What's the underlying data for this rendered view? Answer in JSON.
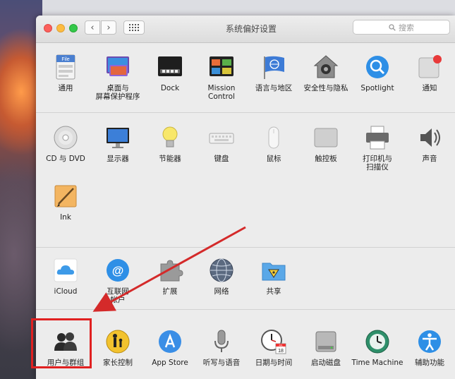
{
  "window": {
    "title": "系统偏好设置",
    "search_placeholder": "搜索"
  },
  "sections": [
    {
      "name": "personal",
      "panes": [
        {
          "id": "general",
          "label": "通用",
          "icon": "general-icon"
        },
        {
          "id": "desktop",
          "label": "桌面与\n屏幕保护程序",
          "icon": "desktop-icon"
        },
        {
          "id": "dock",
          "label": "Dock",
          "icon": "dock-icon"
        },
        {
          "id": "mission-control",
          "label": "Mission\nControl",
          "icon": "mission-control-icon"
        },
        {
          "id": "language",
          "label": "语言与地区",
          "icon": "language-flag-icon"
        },
        {
          "id": "security",
          "label": "安全性与隐私",
          "icon": "security-house-icon"
        },
        {
          "id": "spotlight",
          "label": "Spotlight",
          "icon": "spotlight-icon"
        },
        {
          "id": "notifications",
          "label": "通知",
          "icon": "notifications-icon"
        }
      ]
    },
    {
      "name": "hardware",
      "panes": [
        {
          "id": "cd-dvd",
          "label": "CD 与 DVD",
          "icon": "cd-icon"
        },
        {
          "id": "displays",
          "label": "显示器",
          "icon": "display-icon"
        },
        {
          "id": "energy",
          "label": "节能器",
          "icon": "lightbulb-icon"
        },
        {
          "id": "keyboard",
          "label": "键盘",
          "icon": "keyboard-icon"
        },
        {
          "id": "mouse",
          "label": "鼠标",
          "icon": "mouse-icon"
        },
        {
          "id": "trackpad",
          "label": "触控板",
          "icon": "trackpad-icon"
        },
        {
          "id": "printers",
          "label": "打印机与\n扫描仪",
          "icon": "printer-icon"
        },
        {
          "id": "sound",
          "label": "声音",
          "icon": "speaker-icon"
        },
        {
          "id": "ink",
          "label": "Ink",
          "icon": "ink-icon"
        }
      ]
    },
    {
      "name": "internet",
      "panes": [
        {
          "id": "icloud",
          "label": "iCloud",
          "icon": "icloud-icon"
        },
        {
          "id": "internet-accounts",
          "label": "互联网\n帐户",
          "icon": "at-sign-icon"
        },
        {
          "id": "extensions",
          "label": "扩展",
          "icon": "puzzle-icon"
        },
        {
          "id": "network",
          "label": "网络",
          "icon": "globe-icon"
        },
        {
          "id": "sharing",
          "label": "共享",
          "icon": "sharing-folder-icon"
        }
      ]
    },
    {
      "name": "system",
      "panes": [
        {
          "id": "users",
          "label": "用户与群组",
          "icon": "users-icon"
        },
        {
          "id": "parental",
          "label": "家长控制",
          "icon": "parental-icon"
        },
        {
          "id": "appstore",
          "label": "App Store",
          "icon": "appstore-icon"
        },
        {
          "id": "dictation",
          "label": "听写与语音",
          "icon": "microphone-icon"
        },
        {
          "id": "datetime",
          "label": "日期与时间",
          "icon": "clock-calendar-icon"
        },
        {
          "id": "startup",
          "label": "启动磁盘",
          "icon": "disk-icon"
        },
        {
          "id": "timemachine",
          "label": "Time Machine",
          "icon": "time-machine-icon"
        },
        {
          "id": "accessibility",
          "label": "辅助功能",
          "icon": "accessibility-icon"
        }
      ]
    }
  ],
  "calendar_month": "JUL",
  "calendar_day": "18",
  "colors": {
    "highlight": "#e02020",
    "arrow": "#d42a2a"
  }
}
